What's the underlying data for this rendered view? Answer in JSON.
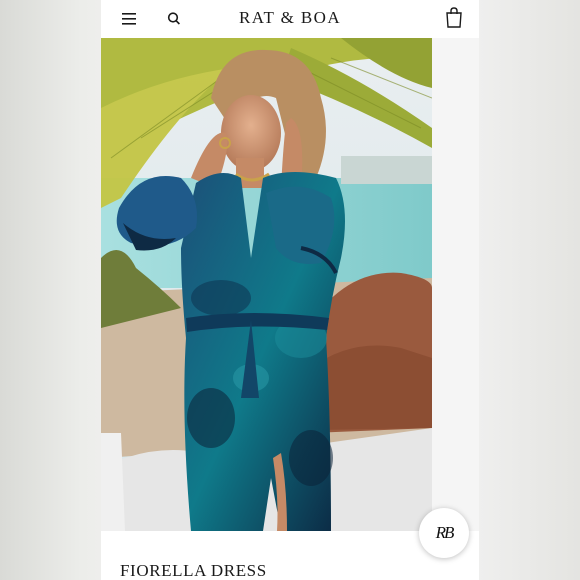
{
  "header": {
    "brand": "RAT & BOA",
    "menu_icon": "hamburger-menu-icon",
    "search_icon": "search-icon",
    "bag_icon": "shopping-bag-icon"
  },
  "product": {
    "name": "FIORELLA DRESS",
    "image_alt": "Model wearing blue floral wrap dress with ruffled sleeves by a palm tree and the sea"
  },
  "badge": {
    "monogram": "RB"
  },
  "colors": {
    "dress_primary": "#1f5f8a",
    "dress_dark": "#0e2a44",
    "sea": "#8fd3d3",
    "palm": "#a7b53a"
  }
}
